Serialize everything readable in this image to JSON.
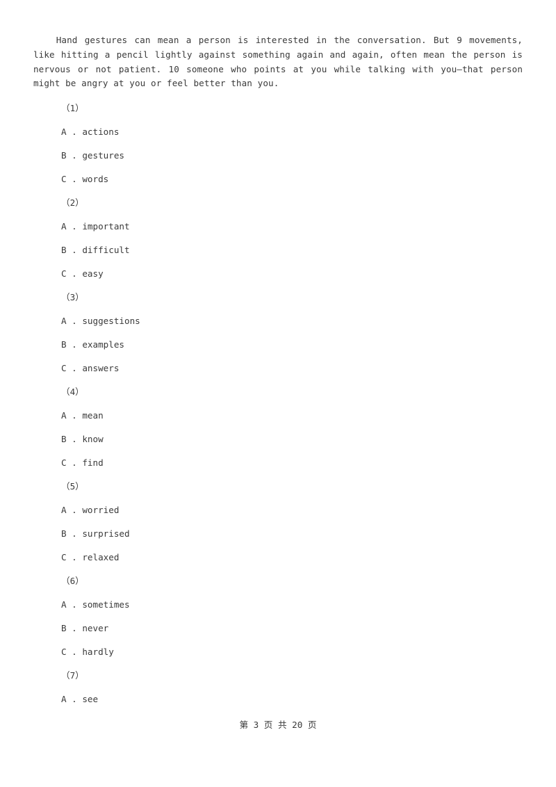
{
  "document": {
    "passage_paragraph": "Hand gestures can mean a person is interested in the conversation. But 9 movements, like hitting a pencil lightly against something again and again, often mean the person is nervous or not patient. 10 someone who points at you while talking with you—that person might be angry at you or feel better than you.",
    "footer": "第 3 页 共 20 页",
    "page_number": "3",
    "total_pages": "20",
    "text_color": "#3a3a3a",
    "background_color": "#ffffff"
  },
  "questions": [
    {
      "number": "（1）",
      "options": [
        {
          "letter": "A",
          "sep": " . ",
          "text": "actions"
        },
        {
          "letter": "B",
          "sep": " . ",
          "text": "gestures"
        },
        {
          "letter": "C",
          "sep": " . ",
          "text": "words"
        }
      ]
    },
    {
      "number": "（2）",
      "options": [
        {
          "letter": "A",
          "sep": " . ",
          "text": "important"
        },
        {
          "letter": "B",
          "sep": " . ",
          "text": "difficult"
        },
        {
          "letter": "C",
          "sep": " . ",
          "text": "easy"
        }
      ]
    },
    {
      "number": "（3）",
      "options": [
        {
          "letter": "A",
          "sep": " . ",
          "text": "suggestions"
        },
        {
          "letter": "B",
          "sep": " . ",
          "text": "examples"
        },
        {
          "letter": "C",
          "sep": " . ",
          "text": "answers"
        }
      ]
    },
    {
      "number": "（4）",
      "options": [
        {
          "letter": "A",
          "sep": " . ",
          "text": "mean"
        },
        {
          "letter": "B",
          "sep": " . ",
          "text": "know"
        },
        {
          "letter": "C",
          "sep": " . ",
          "text": "find"
        }
      ]
    },
    {
      "number": "（5）",
      "options": [
        {
          "letter": "A",
          "sep": " . ",
          "text": "worried"
        },
        {
          "letter": "B",
          "sep": " . ",
          "text": "surprised"
        },
        {
          "letter": "C",
          "sep": " . ",
          "text": "relaxed"
        }
      ]
    },
    {
      "number": "（6）",
      "options": [
        {
          "letter": "A",
          "sep": " . ",
          "text": "sometimes"
        },
        {
          "letter": "B",
          "sep": " . ",
          "text": "never"
        },
        {
          "letter": "C",
          "sep": " . ",
          "text": "hardly"
        }
      ]
    },
    {
      "number": "（7）",
      "options": [
        {
          "letter": "A",
          "sep": " . ",
          "text": "see"
        }
      ]
    }
  ]
}
